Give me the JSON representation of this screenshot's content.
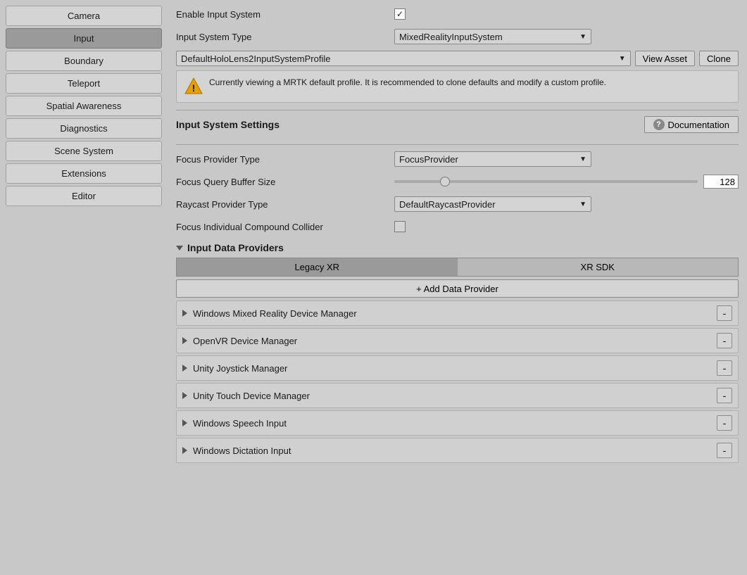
{
  "sidebar": {
    "items": [
      {
        "label": "Camera",
        "active": false
      },
      {
        "label": "Input",
        "active": true
      },
      {
        "label": "Boundary",
        "active": false
      },
      {
        "label": "Teleport",
        "active": false
      },
      {
        "label": "Spatial Awareness",
        "active": false
      },
      {
        "label": "Diagnostics",
        "active": false
      },
      {
        "label": "Scene System",
        "active": false
      },
      {
        "label": "Extensions",
        "active": false
      },
      {
        "label": "Editor",
        "active": false
      }
    ]
  },
  "main": {
    "enable_input_label": "Enable Input System",
    "input_system_type_label": "Input System Type",
    "input_system_type_value": "MixedRealityInputSystem",
    "profile_value": "DefaultHoloLens2InputSystemProfile",
    "view_asset_label": "View Asset",
    "clone_label": "Clone",
    "warning_text": "Currently viewing a MRTK default profile. It is recommended to clone defaults and modify a custom profile.",
    "section_title": "Input System Settings",
    "doc_label": "Documentation",
    "focus_provider_label": "Focus Provider Type",
    "focus_provider_value": "FocusProvider",
    "focus_query_label": "Focus Query Buffer Size",
    "focus_query_value": "128",
    "raycast_label": "Raycast Provider Type",
    "raycast_value": "DefaultRaycastProvider",
    "compound_label": "Focus Individual Compound Collider",
    "providers_title": "Input Data Providers",
    "tab_legacy": "Legacy XR",
    "tab_xr_sdk": "XR SDK",
    "add_provider_label": "+ Add Data Provider",
    "providers": [
      {
        "label": "Windows Mixed Reality Device Manager"
      },
      {
        "label": "OpenVR Device Manager"
      },
      {
        "label": "Unity Joystick Manager"
      },
      {
        "label": "Unity Touch Device Manager"
      },
      {
        "label": "Windows Speech Input"
      },
      {
        "label": "Windows Dictation Input"
      }
    ],
    "remove_label": "-"
  }
}
